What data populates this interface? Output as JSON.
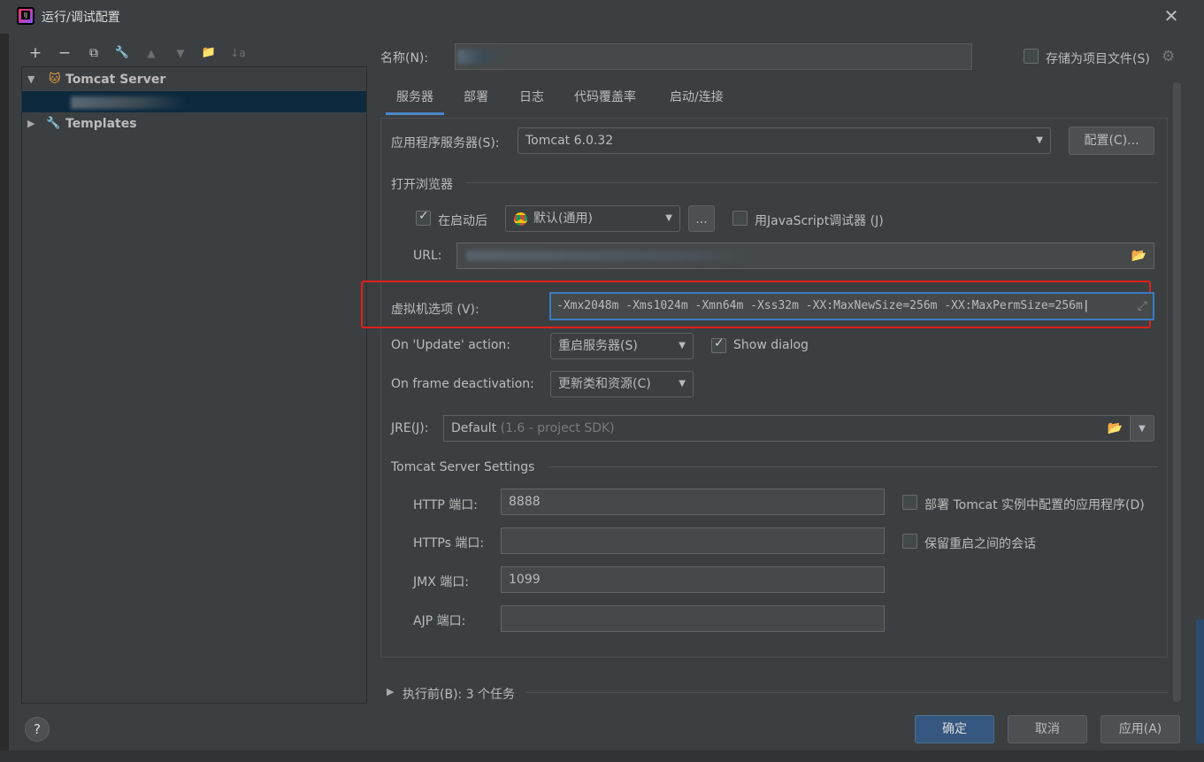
{
  "window": {
    "title": "运行/调试配置",
    "close": "✕",
    "logo": "IJ"
  },
  "toolbar": {
    "add": "+",
    "remove": "−",
    "copy": "⧉",
    "edit": "🔧",
    "up": "▲",
    "down": "▼",
    "folder": "📁",
    "sort": "↓a"
  },
  "tree": {
    "root_label": "Tomcat Server",
    "templates_label": "Templates"
  },
  "name_label": "名称(N):",
  "store_label": "存储为项目文件(S)",
  "tabs": [
    "服务器",
    "部署",
    "日志",
    "代码覆盖率",
    "启动/连接"
  ],
  "server": {
    "app_server_label": "应用程序服务器(S):",
    "app_server_value": "Tomcat 6.0.32",
    "configure_button": "配置(C)...",
    "open_browser_label": "打开浏览器",
    "after_launch_label": "在启动后",
    "browser_value": "默认(通用)",
    "browse_button": "...",
    "js_debugger_label": "用JavaScript调试器 (J)",
    "url_label": "URL:",
    "vm_options_label": "虚拟机选项 (V):",
    "vm_options_value": "-Xmx2048m -Xms1024m -Xmn64m -Xss32m -XX:MaxNewSize=256m -XX:MaxPermSize=256m",
    "on_update_label": "On 'Update' action:",
    "on_update_value": "重启服务器(S)",
    "show_dialog_label": "Show dialog",
    "on_frame_label": "On frame deactivation:",
    "on_frame_value": "更新类和资源(C)",
    "jre_label": "JRE(J):",
    "jre_value": "Default",
    "jre_hint": "(1.6 - project SDK)",
    "tomcat_settings_label": "Tomcat Server Settings",
    "http_port_label": "HTTP 端口:",
    "http_port_value": "8888",
    "https_port_label": "HTTPs 端口:",
    "https_port_value": "",
    "jmx_port_label": "JMX 端口:",
    "jmx_port_value": "1099",
    "ajp_port_label": "AJP 端口:",
    "ajp_port_value": "",
    "deploy_apps_label": "部署 Tomcat 实例中配置的应用程序(D)",
    "preserve_sessions_label": "保留重启之间的会话"
  },
  "before_launch_label": "执行前(B): 3 个任务",
  "buttons": {
    "ok": "确定",
    "cancel": "取消",
    "apply": "应用(A)",
    "help": "?"
  },
  "colors": {
    "accent": "#365880",
    "highlight_box": "#e0201a",
    "background": "#3c3f41"
  }
}
